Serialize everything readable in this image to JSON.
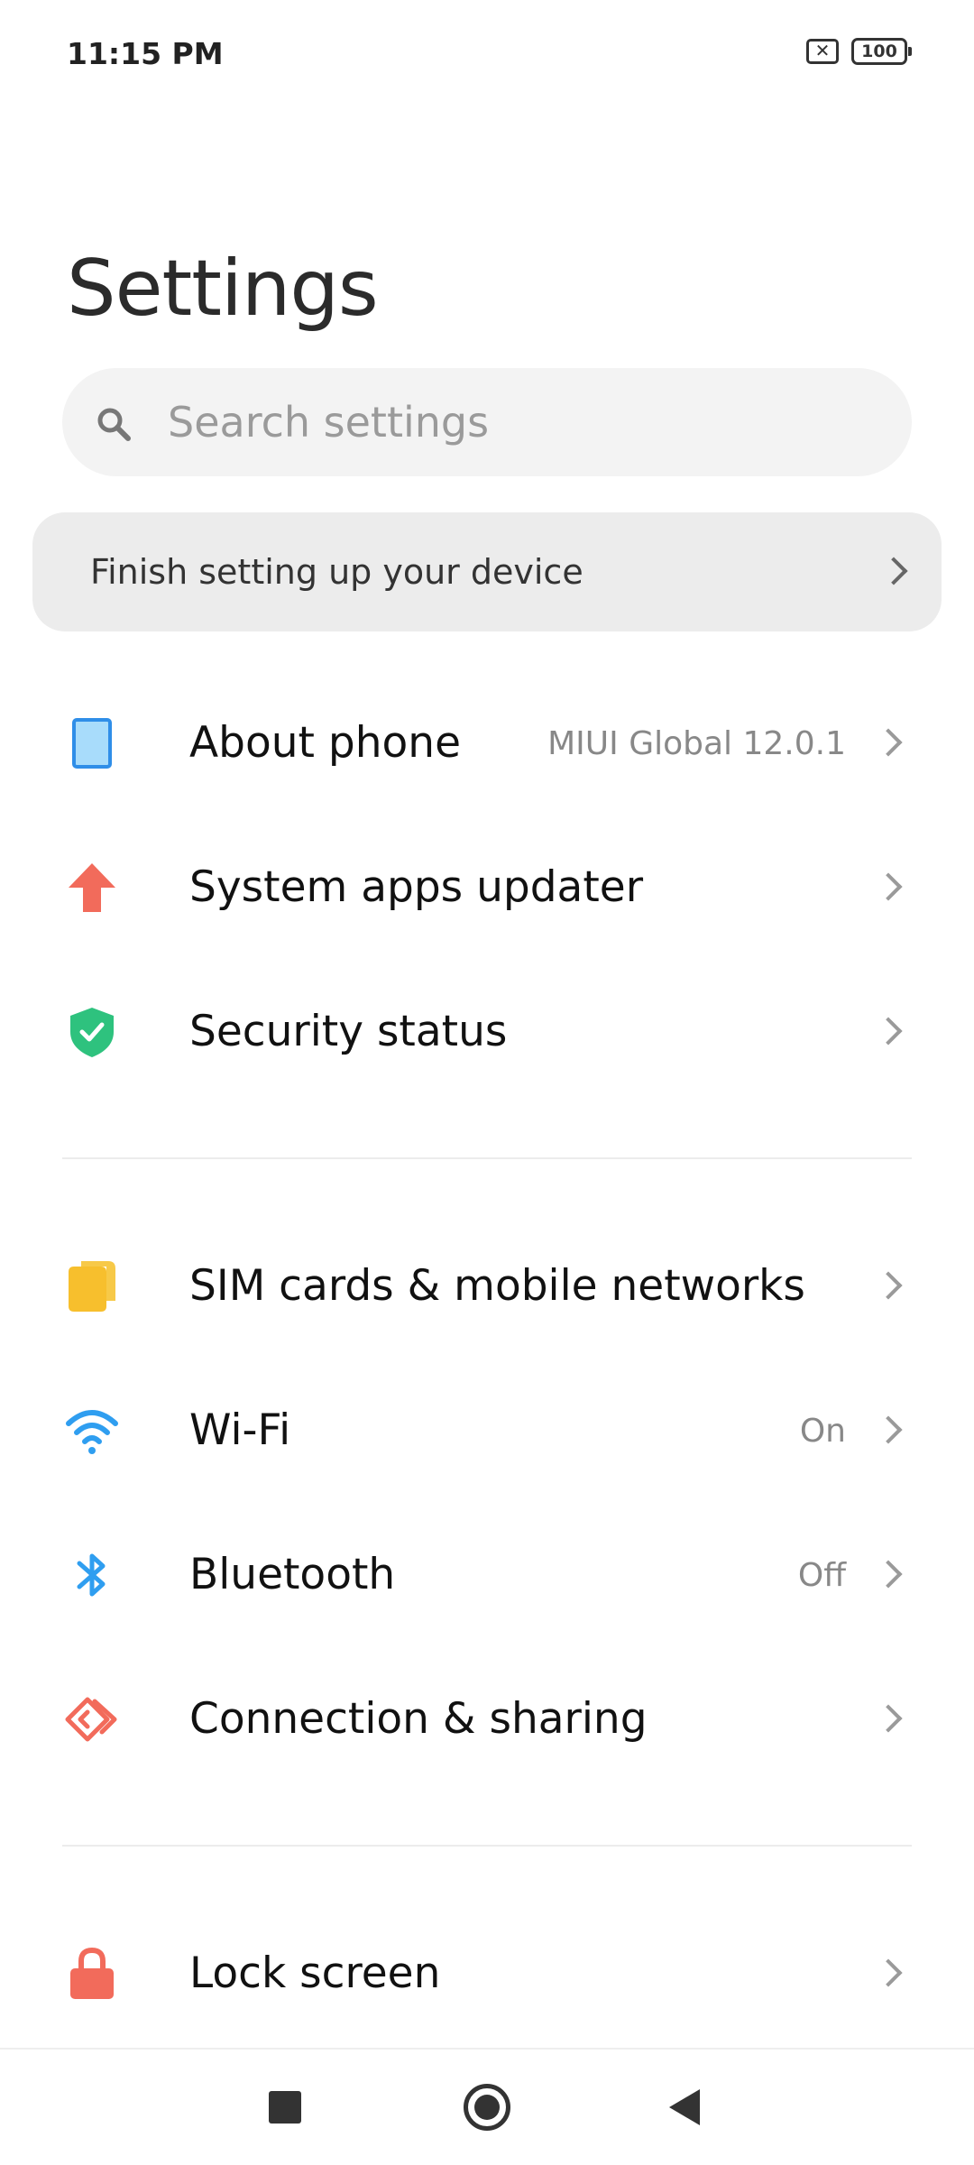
{
  "status_bar": {
    "time": "11:15 PM",
    "battery": "100",
    "sim_icon": "sim-x-icon",
    "battery_icon": "battery-icon"
  },
  "page": {
    "title": "Settings"
  },
  "search": {
    "placeholder": "Search settings",
    "icon": "search-icon"
  },
  "finish_setup": {
    "label": "Finish setting up your device"
  },
  "items": [
    {
      "label": "About phone",
      "value": "MIUI Global 12.0.1",
      "icon": "phone-icon",
      "color": "#2f8ee8"
    },
    {
      "label": "System apps updater",
      "value": "",
      "icon": "arrow-up-icon",
      "color": "#f26b5b"
    },
    {
      "label": "Security status",
      "value": "",
      "icon": "shield-check-icon",
      "color": "#2ec27e"
    },
    {
      "label": "SIM cards & mobile networks",
      "value": "",
      "icon": "sim-card-icon",
      "color": "#f7bf2d"
    },
    {
      "label": "Wi-Fi",
      "value": "On",
      "icon": "wifi-icon",
      "color": "#2f9ef0"
    },
    {
      "label": "Bluetooth",
      "value": "Off",
      "icon": "bluetooth-icon",
      "color": "#2f9ef0"
    },
    {
      "label": "Connection & sharing",
      "value": "",
      "icon": "connection-sharing-icon",
      "color": "#f26b5b"
    },
    {
      "label": "Lock screen",
      "value": "",
      "icon": "lock-icon",
      "color": "#f26b5b"
    }
  ],
  "nav_bar": {
    "recents_icon": "recents-icon",
    "home_icon": "home-icon",
    "back_icon": "back-icon"
  }
}
